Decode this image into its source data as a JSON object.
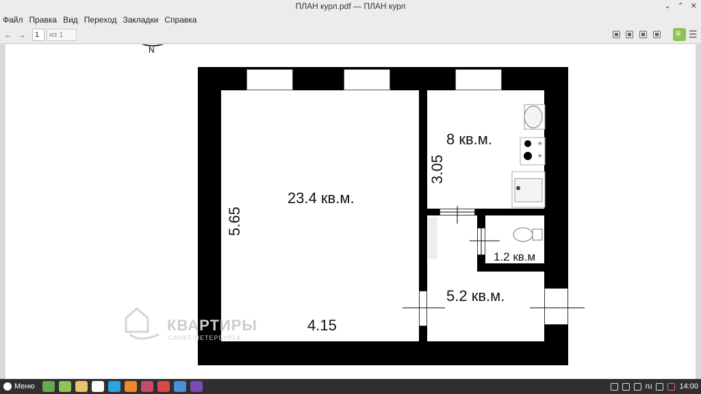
{
  "window": {
    "title": "ПЛАН курл.pdf — ПЛАН курл"
  },
  "menu": {
    "items": [
      "Файл",
      "Правка",
      "Вид",
      "Переход",
      "Закладки",
      "Справка"
    ]
  },
  "toolbar": {
    "page_value": "1",
    "page_of": "из 1"
  },
  "document": {
    "compass_label": "N",
    "rooms": {
      "main_area": "23.4 кв.м.",
      "kitchen_area": "8 кв.м.",
      "bath_area": "1.2 кв.м",
      "hall_area": "5.2 кв.м."
    },
    "dimensions": {
      "main_height": "5.65",
      "main_width": "4.15",
      "kitchen_height": "3.05"
    },
    "watermark_title": "КВАРТИРЫ",
    "watermark_sub": "САНКТ-ПЕТЕРБУРГА"
  },
  "taskbar": {
    "menu_label": "Меню",
    "apps": [
      "files",
      "notes",
      "chrome",
      "yandex",
      "telegram",
      "firefox",
      "photos",
      "slack",
      "docs",
      "app"
    ],
    "app_colors": [
      "#6aa84f",
      "#8fc35a",
      "#e9c46a",
      "#ffffff",
      "#2aa3df",
      "#f08a24",
      "#c74b6b",
      "#d84a4a",
      "#4a90d9",
      "#7a4ab8"
    ],
    "keyboard_layout": "ru",
    "clock": "14:00"
  }
}
